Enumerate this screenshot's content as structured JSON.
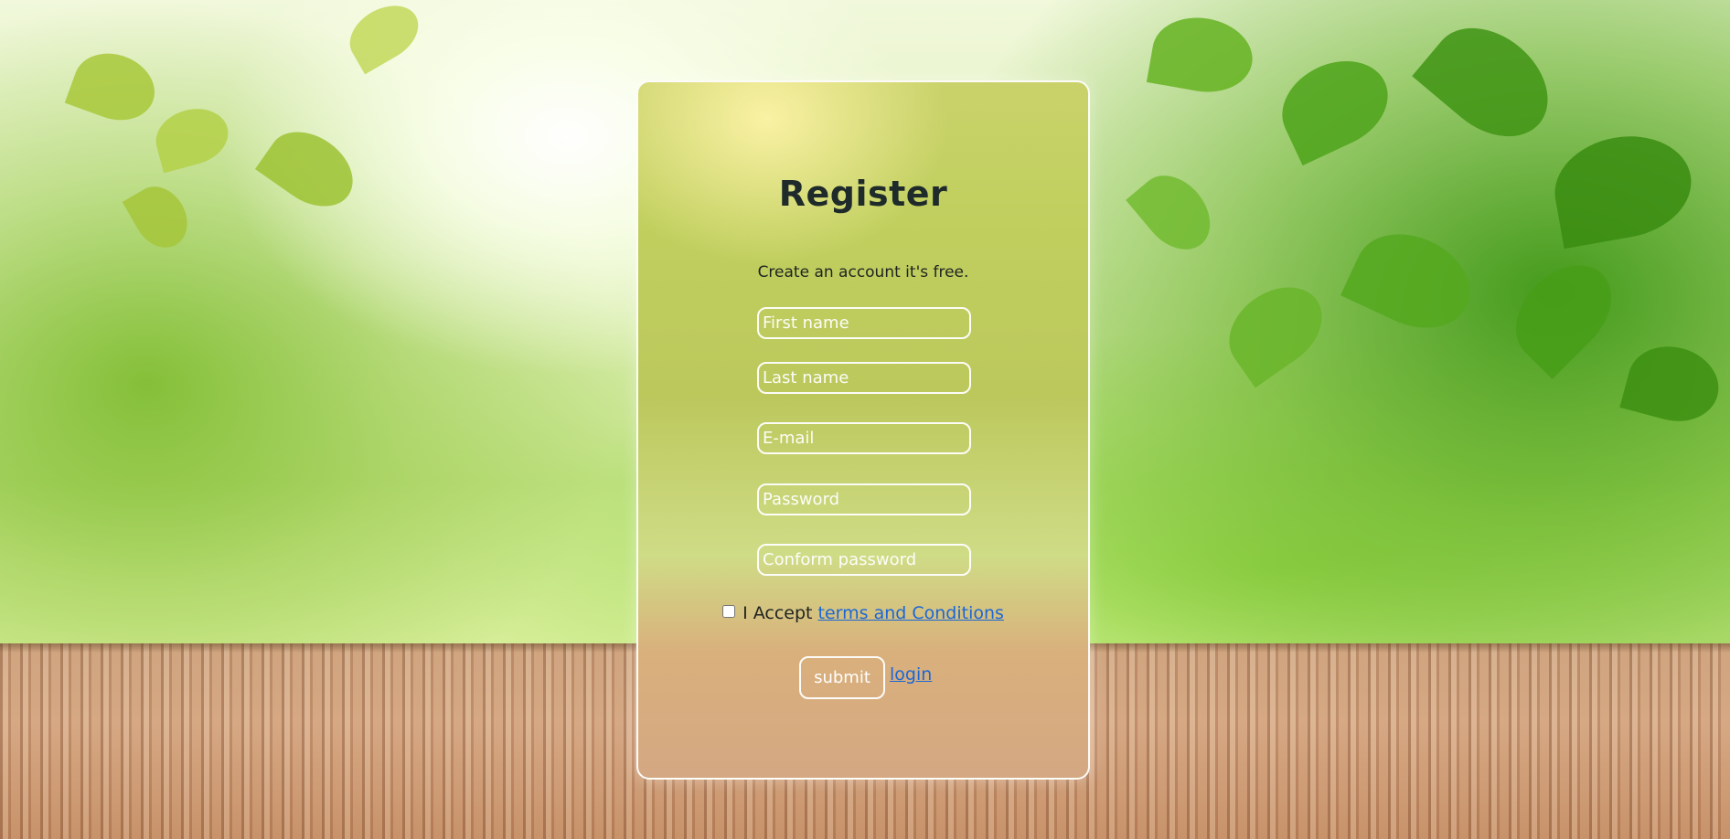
{
  "register_form": {
    "title": "Register",
    "subtitle": "Create an account it's free.",
    "fields": {
      "first_name": {
        "placeholder": "First name",
        "value": ""
      },
      "last_name": {
        "placeholder": "Last name",
        "value": ""
      },
      "email": {
        "placeholder": "E-mail",
        "value": ""
      },
      "password": {
        "placeholder": "Password",
        "value": ""
      },
      "confirm_password": {
        "placeholder": "Conform password",
        "value": ""
      }
    },
    "terms": {
      "prefix": "I Accept",
      "link_text": "terms and Conditions",
      "checked": false
    },
    "submit_label": "submit",
    "login_label": "login"
  },
  "colors": {
    "link": "#1b67d6",
    "title": "#1f2a2a",
    "field_border": "#ffffff"
  }
}
